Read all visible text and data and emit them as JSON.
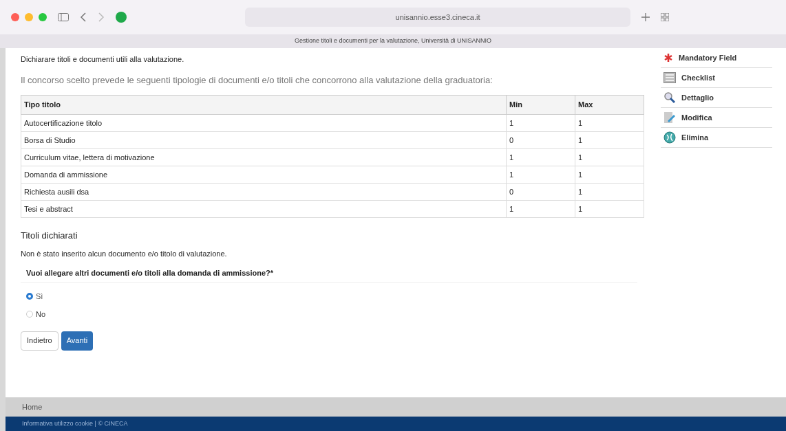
{
  "browser": {
    "address": "unisannio.esse3.cineca.it",
    "tab_title": "Gestione titoli e documenti per la valutazione, Università di UNISANNIO"
  },
  "intro": "Dichiarare titoli e documenti utili alla valutazione.",
  "subtitle": "Il concorso scelto prevede le seguenti tipologie di documenti e/o titoli che concorrono alla valutazione della graduatoria:",
  "table": {
    "columns": [
      "Tipo titolo",
      "Min",
      "Max"
    ],
    "rows": [
      [
        "Autocertificazione titolo",
        "1",
        "1"
      ],
      [
        "Borsa di Studio",
        "0",
        "1"
      ],
      [
        "Curriculum vitae, lettera di motivazione",
        "1",
        "1"
      ],
      [
        "Domanda di ammissione",
        "1",
        "1"
      ],
      [
        "Richiesta ausili dsa",
        "0",
        "1"
      ],
      [
        "Tesi e abstract",
        "1",
        "1"
      ]
    ]
  },
  "declared": {
    "title": "Titoli dichiarati",
    "message": "Non è stato inserito alcun documento e/o titolo di valutazione."
  },
  "question": {
    "label": "Vuoi allegare altri documenti e/o titoli alla domanda di ammissione?*",
    "options": [
      {
        "label": "Sì",
        "selected": true
      },
      {
        "label": "No",
        "selected": false
      }
    ]
  },
  "buttons": [
    {
      "label": "Indietro",
      "kind": "secondary"
    },
    {
      "label": "Avanti",
      "kind": "primary"
    }
  ],
  "legend": [
    {
      "kind": "mandatory",
      "label": "Mandatory Field"
    },
    {
      "kind": "checklist",
      "label": "Checklist"
    },
    {
      "kind": "detail",
      "label": "Dettaglio"
    },
    {
      "kind": "edit",
      "label": "Modifica"
    },
    {
      "kind": "delete",
      "label": "Elimina"
    }
  ],
  "footer": {
    "nav": "Home",
    "bottom": "Informativa utilizzo cookie | © CINECA"
  }
}
